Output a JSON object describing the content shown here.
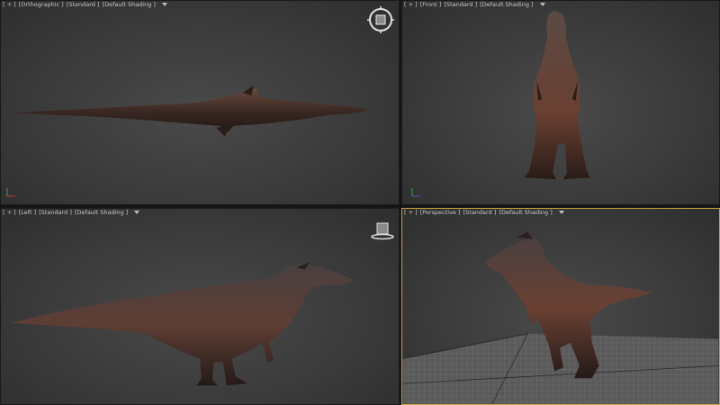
{
  "viewports": {
    "top": {
      "menu": "[ + ]",
      "view": "[Orthographic ]",
      "shading_style": "[Standard ]",
      "shading": "[Default Shading ]"
    },
    "front": {
      "menu": "[ + ]",
      "view": "[Front ]",
      "shading_style": "[Standard ]",
      "shading": "[Default Shading ]"
    },
    "left": {
      "menu": "[ + ]",
      "view": "[Left ]",
      "shading_style": "[Standard ]",
      "shading": "[Default Shading ]"
    },
    "perspective": {
      "menu": "[ + ]",
      "view": "[Perspective ]",
      "shading_style": "[Standard ]",
      "shading": "[Default Shading ]"
    }
  },
  "icons": {
    "filter": "filter-icon",
    "viewcube": "viewcube-icon",
    "axis": "axis-tripod-icon"
  },
  "colors": {
    "active_border": "#c9a33a",
    "label_text": "#c8c8c8",
    "model_skin": "#5a3a2e"
  }
}
